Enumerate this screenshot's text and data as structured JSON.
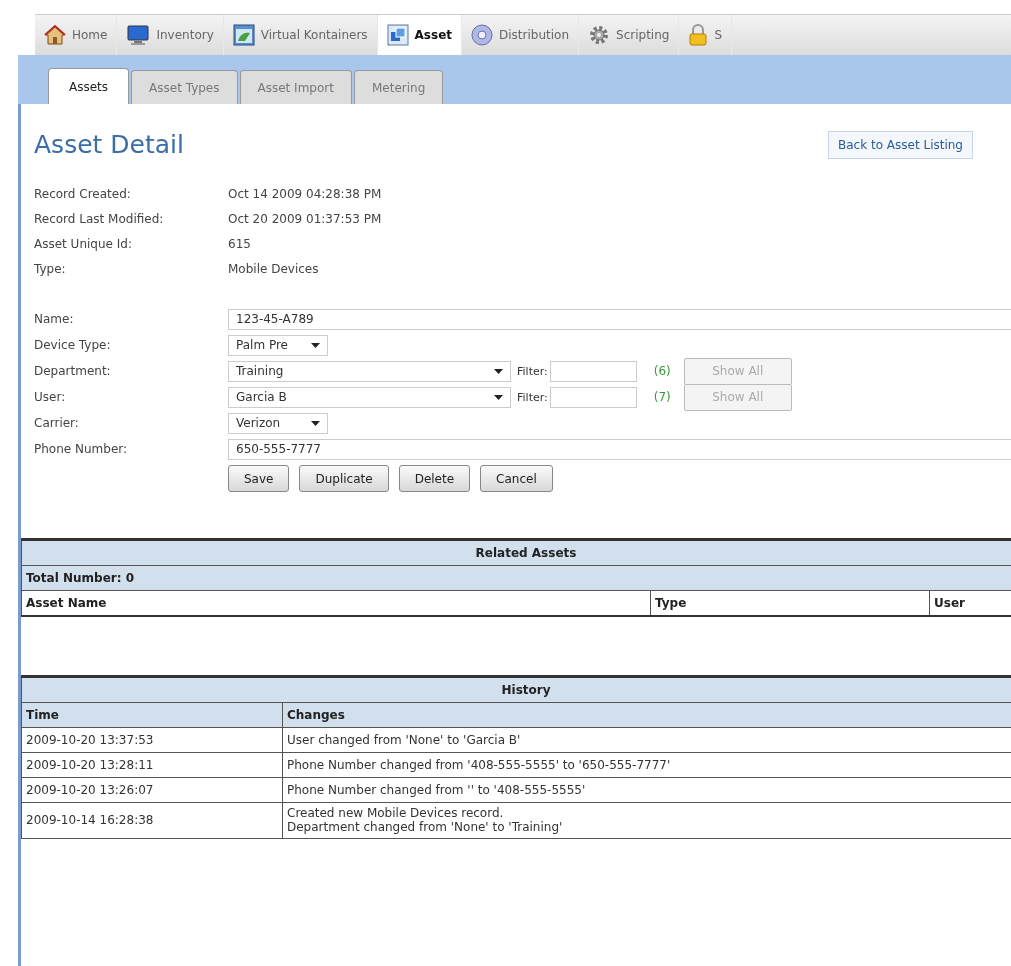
{
  "nav_tabs": [
    {
      "label": "Home",
      "selected": false
    },
    {
      "label": "Inventory",
      "selected": false
    },
    {
      "label": "Virtual Kontainers",
      "selected": false
    },
    {
      "label": "Asset",
      "selected": true
    },
    {
      "label": "Distribution",
      "selected": false
    },
    {
      "label": "Scripting",
      "selected": false
    },
    {
      "label": "S",
      "selected": false
    }
  ],
  "sub_tabs": [
    {
      "label": "Assets",
      "selected": true
    },
    {
      "label": "Asset Types",
      "selected": false
    },
    {
      "label": "Asset Import",
      "selected": false
    },
    {
      "label": "Metering",
      "selected": false
    }
  ],
  "page_title": "Asset Detail",
  "back_button": "Back to Asset Listing",
  "record_info": [
    {
      "label": "Record Created:",
      "value": "Oct 14 2009 04:28:38 PM"
    },
    {
      "label": "Record Last Modified:",
      "value": "Oct 20 2009 01:37:53 PM"
    },
    {
      "label": "Asset Unique Id:",
      "value": "615"
    },
    {
      "label": "Type:",
      "value": "Mobile Devices"
    }
  ],
  "form_fields": [
    {
      "kind": "text",
      "label": "Name:",
      "value": "123-45-A789"
    },
    {
      "kind": "select",
      "label": "Device Type:",
      "value": "Palm Pre"
    },
    {
      "kind": "filter_select",
      "label": "Department:",
      "value": "Training",
      "filter_label": "Filter:",
      "count": "(6)",
      "show_all": {
        "label": "Show All",
        "disabled": true
      }
    },
    {
      "kind": "filter_select",
      "label": "User:",
      "value": "Garcia B",
      "filter_label": "Filter:",
      "count": "(7)",
      "show_all": {
        "label": "Show All",
        "disabled": true
      }
    },
    {
      "kind": "select",
      "label": "Carrier:",
      "value": "Verizon"
    },
    {
      "kind": "text",
      "label": "Phone Number:",
      "value": "650-555-7777"
    }
  ],
  "action_buttons": [
    "Save",
    "Duplicate",
    "Delete",
    "Cancel"
  ],
  "related_assets": {
    "title": "Related Assets",
    "total": "Total Number: 0",
    "columns": [
      "Asset Name",
      "Type",
      "User"
    ]
  },
  "history": {
    "title": "History",
    "columns": [
      "Time",
      "Changes"
    ],
    "rows": [
      {
        "time": "2009-10-20 13:37:53",
        "changes": "User changed from 'None' to 'Garcia B'"
      },
      {
        "time": "2009-10-20 13:28:11",
        "changes": "Phone Number changed from '408-555-5555' to '650-555-7777'"
      },
      {
        "time": "2009-10-20 13:26:07",
        "changes": "Phone Number changed from '' to '408-555-5555'"
      },
      {
        "time": "2009-10-14 16:28:38",
        "changes": "Created new Mobile Devices record.\nDepartment changed from 'None' to 'Training'"
      }
    ]
  }
}
